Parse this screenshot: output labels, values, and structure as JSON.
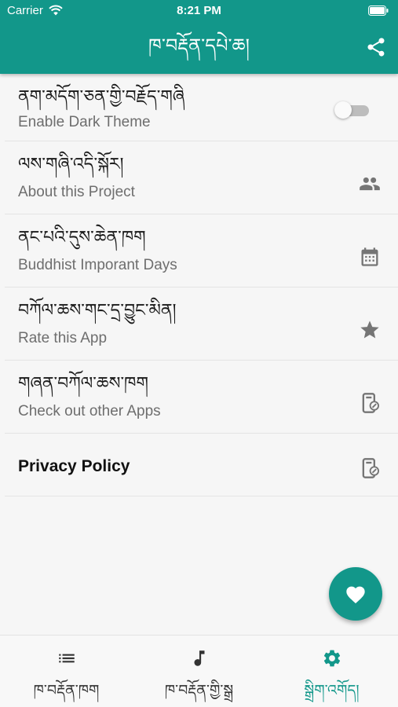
{
  "status_bar": {
    "carrier": "Carrier",
    "time": "8:21 PM"
  },
  "header": {
    "title": "ཁ་བརྡོན་དཔེ་ཆ།"
  },
  "settings": [
    {
      "title": "ནག་མདོག་ཅན་གྱི་བརྗོད་གཞི",
      "subtitle": "Enable Dark Theme",
      "control": "toggle",
      "toggle_on": false
    },
    {
      "title": "ལས་གཞི་འདི་སྐོར།",
      "subtitle": "About this Project",
      "icon": "people-icon"
    },
    {
      "title": "ནང་པའི་དུས་ཆེན་ཁག",
      "subtitle": "Buddhist Imporant Days",
      "icon": "calendar-icon"
    },
    {
      "title": "བཀོལ་ཆས་གང་དྲ་བྱུང་མིན།",
      "subtitle": "Rate this App",
      "icon": "star-icon"
    },
    {
      "title": "གཞན་བཀོལ་ཆས་ཁག",
      "subtitle": "Check out other Apps",
      "icon": "phone-link-icon"
    }
  ],
  "privacy": {
    "label": "Privacy Policy",
    "icon": "phone-link-icon"
  },
  "fab": {
    "icon": "heart-icon"
  },
  "bottom_nav": [
    {
      "label": "ཁ་བརྡོན་ཁག",
      "icon": "list-icon",
      "active": false
    },
    {
      "label": "ཁ་བརྡོན་གྱི་སྒྲ",
      "icon": "music-note-icon",
      "active": false
    },
    {
      "label": "སྒྲིག་འགོད།",
      "icon": "settings-gear-icon",
      "active": true
    }
  ],
  "colors": {
    "primary": "#12978a",
    "icon_gray": "#757575",
    "background": "#f6f6f6"
  }
}
